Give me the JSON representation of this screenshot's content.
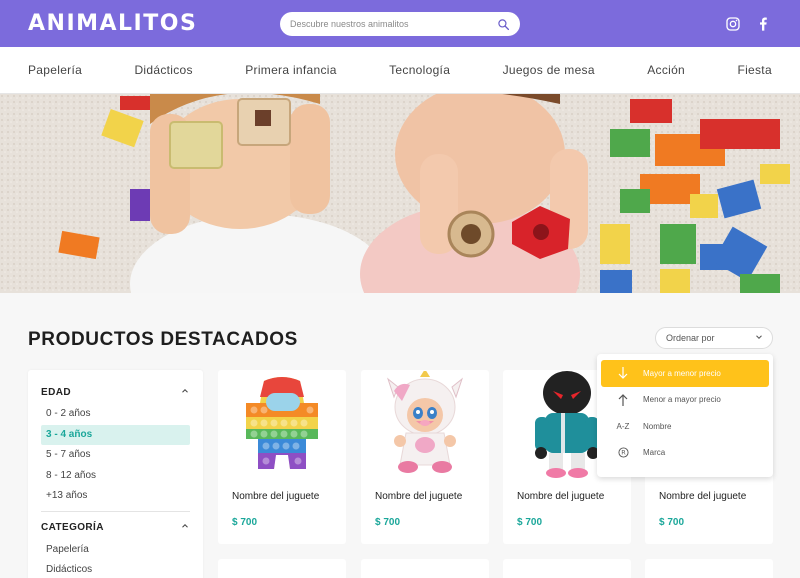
{
  "brand": {
    "logo": "ANIMALITOS",
    "accent_color": "#7c6bdc",
    "highlight_color": "#1ba79a",
    "dropdown_active_color": "#ffc21a"
  },
  "search": {
    "placeholder": "Descubre nuestros animalitos",
    "icon": "search-icon"
  },
  "social": [
    {
      "icon": "instagram-icon"
    },
    {
      "icon": "facebook-icon"
    }
  ],
  "nav": [
    "Papelería",
    "Didácticos",
    "Primera infancia",
    "Tecnología",
    "Juegos de mesa",
    "Acción",
    "Fiesta"
  ],
  "section": {
    "title": "PRODUCTOS DESTACADOS"
  },
  "sort": {
    "label": "Ordenar por",
    "options": [
      {
        "label": "Mayor a menor precio",
        "icon": "arrow-down-icon",
        "active": true
      },
      {
        "label": "Menor a mayor precio",
        "icon": "arrow-up-icon",
        "active": false
      },
      {
        "label": "Nombre",
        "icon": "A-Z",
        "active": false
      },
      {
        "label": "Marca",
        "icon": "R",
        "active": false
      }
    ]
  },
  "filters": {
    "age": {
      "title": "EDAD",
      "options": [
        "0 - 2 años",
        "3 - 4 años",
        "5 - 7 años",
        "8 - 12 años",
        "+13 años"
      ],
      "selected": "3 - 4 años"
    },
    "category": {
      "title": "CATEGORÍA",
      "options": [
        "Papelería",
        "Didácticos"
      ]
    }
  },
  "products": [
    {
      "name": "Nombre del juguete",
      "price": "$ 700"
    },
    {
      "name": "Nombre del juguete",
      "price": "$ 700"
    },
    {
      "name": "Nombre del juguete",
      "price": "$ 700"
    },
    {
      "name": "Nombre del juguete",
      "price": "$ 700"
    }
  ]
}
